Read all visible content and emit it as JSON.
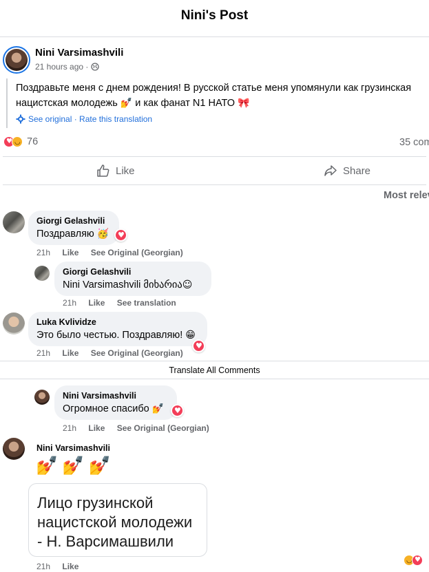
{
  "header": {
    "title": "Nini's Post"
  },
  "post": {
    "author": "Nini Varsimashvili",
    "time": "21 hours ago ·",
    "text_line1": "Поздравьте меня с днем рождения! В русской статье меня упомянули как грузинская",
    "text_line2": "нацистская молодежь",
    "text_line2b": "и как фанат N1 НАТО",
    "see_original": "See original · Rate this translation",
    "reaction_count": "76",
    "comment_count": "35 com",
    "like_label": "Like",
    "share_label": "Share",
    "sort_label": "Most relev"
  },
  "comments": [
    {
      "name": "Giorgi Gelashvili",
      "text": "Поздравляю",
      "time": "21h",
      "like": "Like",
      "extra": "See Original (Georgian)"
    },
    {
      "name": "Giorgi Gelashvili",
      "text": "Nini Varsimashvili მიხარია",
      "time": "21h",
      "like": "Like",
      "extra": "See translation"
    },
    {
      "name": "Luka Kvlividze",
      "text": "Это было честью. Поздравляю!",
      "time": "21h",
      "like": "Like",
      "extra": "See Original (Georgian)"
    },
    {
      "name": "Nini Varsimashvili",
      "text": "Огромное спасибо",
      "time": "21h",
      "like": "Like",
      "extra": "See Original (Georgian)"
    },
    {
      "name": "Nini Varsimashvili",
      "time": "21h",
      "like": "Like",
      "image_text": [
        "Лицо грузинской",
        "нацистской молодежи",
        "- Н. Варсимашвили"
      ]
    }
  ],
  "translate_all": "Translate All Comments",
  "icons": [
    "globe-icon",
    "gear-icon",
    "like-thumb-icon",
    "share-arrow-icon",
    "heart-reaction-icon",
    "haha-reaction-icon"
  ]
}
